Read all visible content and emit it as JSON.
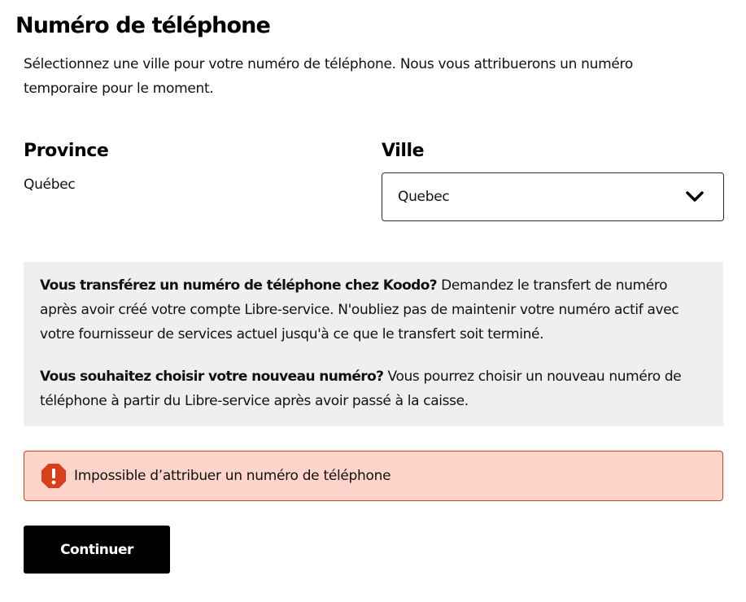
{
  "page": {
    "title": "Numéro de téléphone",
    "intro": "Sélectionnez une ville pour votre numéro de téléphone. Nous vous attribuerons un numéro temporaire pour le moment."
  },
  "province": {
    "label": "Province",
    "value": "Québec"
  },
  "ville": {
    "label": "Ville",
    "selected": "Quebec",
    "icon": "chevron-down-icon"
  },
  "info": {
    "transfer_bold": "Vous transférez un numéro de téléphone chez Koodo?",
    "transfer_text": " Demandez le transfert de numéro après avoir créé votre compte Libre-service. N'oubliez pas de maintenir votre numéro actif avec votre fournisseur de services actuel jusqu'à ce que le transfert soit terminé.",
    "choose_bold": "Vous souhaitez choisir votre nouveau numéro?",
    "choose_text": " Vous pourrez choisir un nouveau numéro de téléphone à partir du Libre-service après avoir passé à la caisse."
  },
  "error": {
    "icon": "error-octagon-icon",
    "message": "Impossible d’attribuer un numéro de téléphone"
  },
  "actions": {
    "continue_label": "Continuer"
  },
  "colors": {
    "error_background": "#ffd4ca",
    "error_border": "#d2451e",
    "error_icon": "#d6401b",
    "info_background": "#efefef",
    "button_background": "#000000"
  }
}
